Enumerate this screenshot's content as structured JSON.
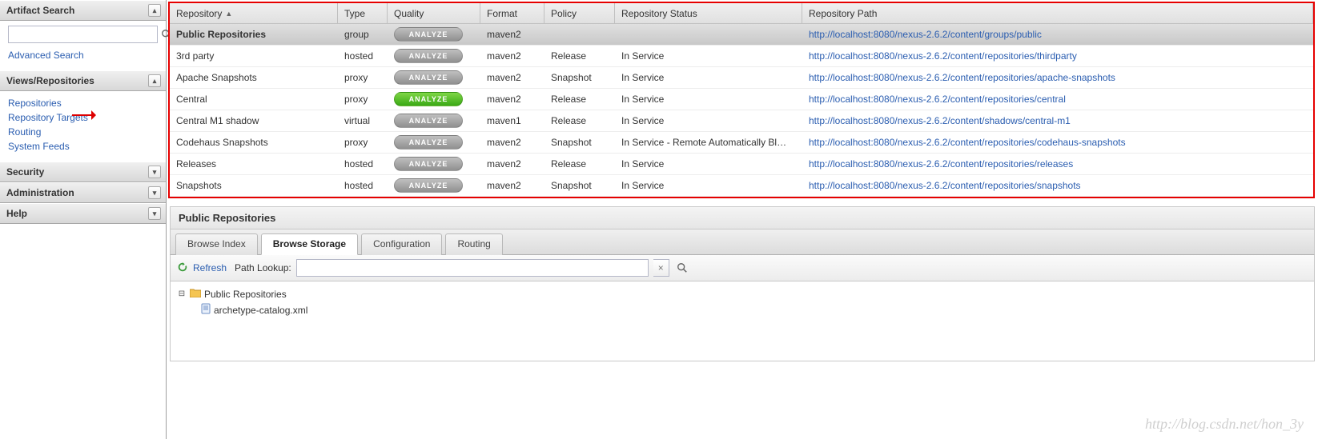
{
  "sidebar": {
    "artifact_search": {
      "title": "Artifact Search",
      "advanced": "Advanced Search"
    },
    "views": {
      "title": "Views/Repositories",
      "items": [
        {
          "label": "Repositories",
          "highlighted": true
        },
        {
          "label": "Repository Targets",
          "highlighted": false
        },
        {
          "label": "Routing",
          "highlighted": false
        },
        {
          "label": "System Feeds",
          "highlighted": false
        }
      ]
    },
    "security_title": "Security",
    "admin_title": "Administration",
    "help_title": "Help"
  },
  "grid": {
    "headers": {
      "repository": "Repository",
      "type": "Type",
      "quality": "Quality",
      "format": "Format",
      "policy": "Policy",
      "status": "Repository Status",
      "path": "Repository Path"
    },
    "analyze_label": "ANALYZE",
    "rows": [
      {
        "repo": "Public Repositories",
        "type": "group",
        "quality": "gray",
        "format": "maven2",
        "policy": "",
        "status": "",
        "path": "http://localhost:8080/nexus-2.6.2/content/groups/public",
        "selected": true
      },
      {
        "repo": "3rd party",
        "type": "hosted",
        "quality": "gray",
        "format": "maven2",
        "policy": "Release",
        "status": "In Service",
        "path": "http://localhost:8080/nexus-2.6.2/content/repositories/thirdparty",
        "selected": false
      },
      {
        "repo": "Apache Snapshots",
        "type": "proxy",
        "quality": "gray",
        "format": "maven2",
        "policy": "Snapshot",
        "status": "In Service",
        "path": "http://localhost:8080/nexus-2.6.2/content/repositories/apache-snapshots",
        "selected": false
      },
      {
        "repo": "Central",
        "type": "proxy",
        "quality": "green",
        "format": "maven2",
        "policy": "Release",
        "status": "In Service",
        "path": "http://localhost:8080/nexus-2.6.2/content/repositories/central",
        "selected": false
      },
      {
        "repo": "Central M1 shadow",
        "type": "virtual",
        "quality": "gray",
        "format": "maven1",
        "policy": "Release",
        "status": "In Service",
        "path": "http://localhost:8080/nexus-2.6.2/content/shadows/central-m1",
        "selected": false
      },
      {
        "repo": "Codehaus Snapshots",
        "type": "proxy",
        "quality": "gray",
        "format": "maven2",
        "policy": "Snapshot",
        "status": "In Service - Remote Automatically Bl…",
        "path": "http://localhost:8080/nexus-2.6.2/content/repositories/codehaus-snapshots",
        "selected": false
      },
      {
        "repo": "Releases",
        "type": "hosted",
        "quality": "gray",
        "format": "maven2",
        "policy": "Release",
        "status": "In Service",
        "path": "http://localhost:8080/nexus-2.6.2/content/repositories/releases",
        "selected": false
      },
      {
        "repo": "Snapshots",
        "type": "hosted",
        "quality": "gray",
        "format": "maven2",
        "policy": "Snapshot",
        "status": "In Service",
        "path": "http://localhost:8080/nexus-2.6.2/content/repositories/snapshots",
        "selected": false
      }
    ]
  },
  "detail": {
    "title": "Public Repositories",
    "tabs": [
      {
        "label": "Browse Index",
        "active": false
      },
      {
        "label": "Browse Storage",
        "active": true
      },
      {
        "label": "Configuration",
        "active": false
      },
      {
        "label": "Routing",
        "active": false
      }
    ],
    "toolbar": {
      "refresh": "Refresh",
      "lookup_label": "Path Lookup:"
    },
    "tree": {
      "root": "Public Repositories",
      "child": "archetype-catalog.xml"
    }
  },
  "watermark": "http://blog.csdn.net/hon_3y"
}
